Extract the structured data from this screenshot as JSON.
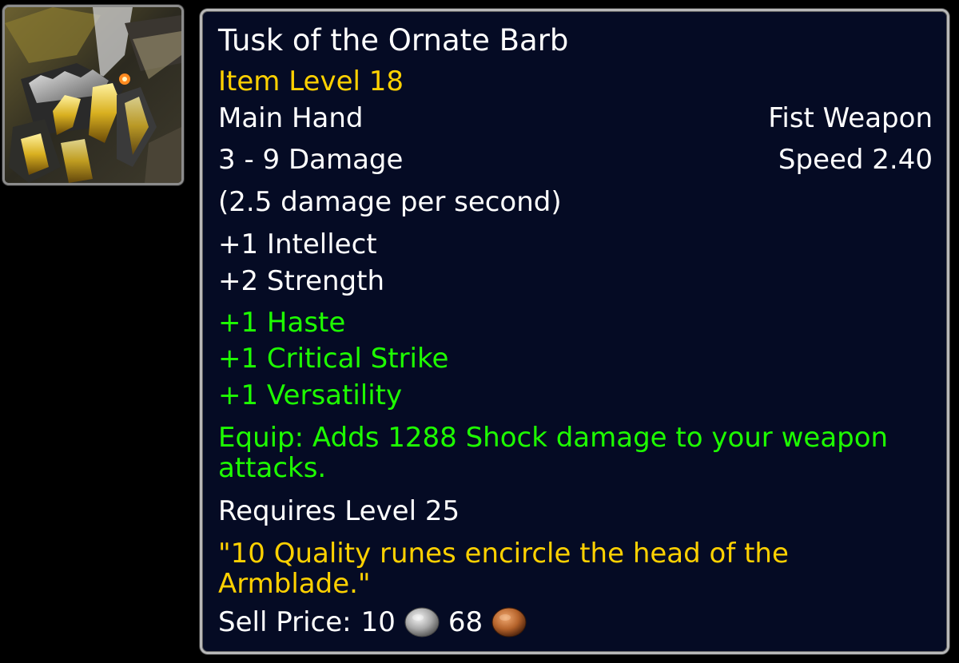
{
  "item": {
    "name": "Tusk of the Ornate Barb",
    "name_color": "#ffffff",
    "item_level": "Item Level 18",
    "slot": "Main Hand",
    "weapon_type": "Fist Weapon",
    "damage": "3 - 9 Damage",
    "speed": "Speed 2.40",
    "dps": "(2.5 damage per second)",
    "stats": [
      "+1 Intellect",
      "+2 Strength"
    ],
    "secondary_stats": [
      "+1 Haste",
      "+1 Critical Strike",
      "+1 Versatility"
    ],
    "equip_effect": "Equip: Adds 1288 Shock damage to your weapon attacks.",
    "requires_level": "Requires Level 25",
    "flavor_text": "\"10 Quality runes encircle the head of the Armblade.\"",
    "sell_price": {
      "label": "Sell Price:",
      "silver": "10",
      "copper": "68"
    },
    "icon": "fist-weapon-armblade-icon"
  },
  "colors": {
    "background": "#000000",
    "tooltip_bg": "#050b24",
    "tooltip_border": "#b8b8b8",
    "white_text": "#ffffff",
    "gold_text": "#ffd100",
    "green_text": "#1eff00",
    "silver_coin": "#a9a9a9",
    "copper_coin": "#b5632b"
  }
}
